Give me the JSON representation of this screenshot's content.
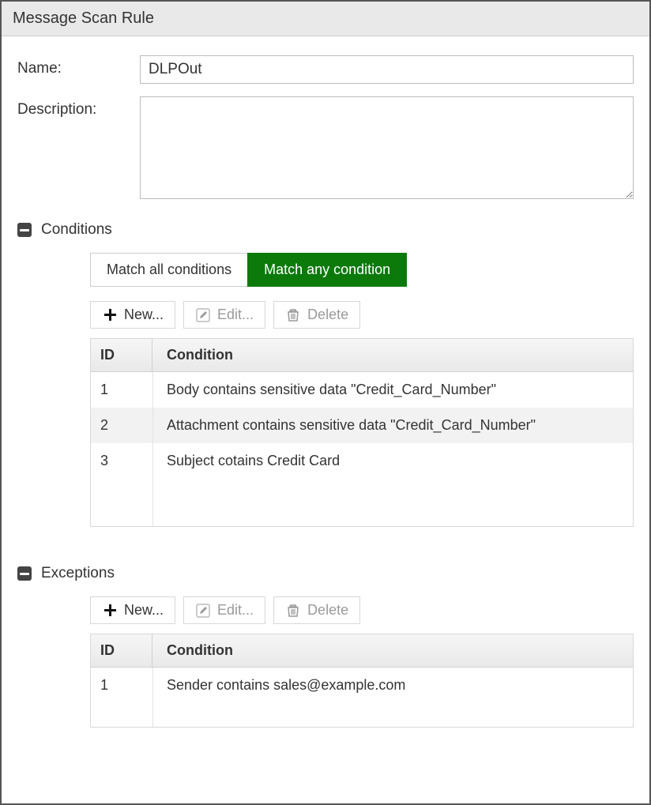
{
  "window": {
    "title": "Message Scan Rule"
  },
  "form": {
    "name_label": "Name:",
    "name_value": "DLPOut",
    "description_label": "Description:",
    "description_value": ""
  },
  "sections": {
    "conditions": {
      "title": "Conditions",
      "match_modes": {
        "all": "Match all conditions",
        "any": "Match any condition",
        "active": "any"
      },
      "toolbar": {
        "new": "New...",
        "edit": "Edit...",
        "delete": "Delete"
      },
      "columns": {
        "id": "ID",
        "condition": "Condition"
      },
      "rows": [
        {
          "id": "1",
          "condition": "Body contains sensitive data \"Credit_Card_Number\""
        },
        {
          "id": "2",
          "condition": "Attachment contains sensitive data \"Credit_Card_Number\""
        },
        {
          "id": "3",
          "condition": "Subject cotains Credit Card"
        }
      ]
    },
    "exceptions": {
      "title": "Exceptions",
      "toolbar": {
        "new": "New...",
        "edit": "Edit...",
        "delete": "Delete"
      },
      "columns": {
        "id": "ID",
        "condition": "Condition"
      },
      "rows": [
        {
          "id": "1",
          "condition": "Sender contains sales@example.com"
        }
      ]
    }
  }
}
